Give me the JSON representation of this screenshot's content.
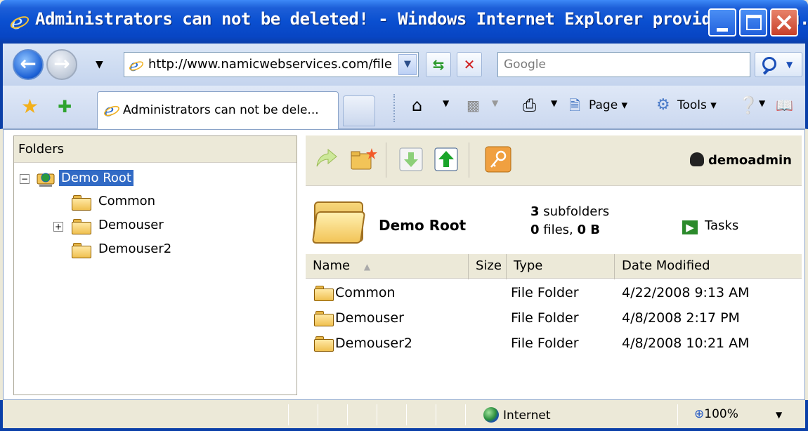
{
  "window": {
    "title": "Administrators can not be deleted! - Windows Internet Explorer provided by you..."
  },
  "address_bar": {
    "url": "http://www.namicwebservices.com/file",
    "search_placeholder": "Google"
  },
  "tabs": [
    {
      "label": "Administrators can not be dele..."
    }
  ],
  "command_bar": {
    "page_label": "Page",
    "tools_label": "Tools"
  },
  "folders_pane": {
    "header": "Folders",
    "tree": [
      {
        "label": "Demo Root",
        "selected": true,
        "expanded": true
      },
      {
        "label": "Common"
      },
      {
        "label": "Demouser",
        "has_children": true
      },
      {
        "label": "Demouser2"
      }
    ]
  },
  "toolbar": {
    "username": "demoadmin"
  },
  "summary": {
    "folder_name": "Demo Root",
    "subfolder_count": "3",
    "subfolders_label": "subfolders",
    "file_count": "0",
    "files_label": "files,",
    "size": "0 B",
    "tasks_label": "Tasks"
  },
  "file_list": {
    "columns": [
      "Name",
      "Size",
      "Type",
      "Date Modified"
    ],
    "rows": [
      {
        "name": "Common",
        "type": "File Folder",
        "date": "4/22/2008 9:13 AM"
      },
      {
        "name": "Demouser",
        "type": "File Folder",
        "date": "4/8/2008 2:17 PM"
      },
      {
        "name": "Demouser2",
        "type": "File Folder",
        "date": "4/8/2008 10:21 AM"
      }
    ]
  },
  "status_bar": {
    "zone": "Internet",
    "zoom": "100%"
  },
  "colors": {
    "titlebar": "#0a4fd0",
    "selection": "#316ac5",
    "panel": "#ece9d8"
  },
  "icons": [
    "ie-logo",
    "back-arrow",
    "forward-arrow",
    "refresh",
    "stop",
    "search",
    "favorites-star",
    "add-favorites",
    "home",
    "feeds",
    "print",
    "page",
    "tools",
    "help",
    "research",
    "folder",
    "up-folder",
    "new-folder",
    "download",
    "upload",
    "key",
    "user",
    "tasks-arrow",
    "globe",
    "zoom"
  ]
}
